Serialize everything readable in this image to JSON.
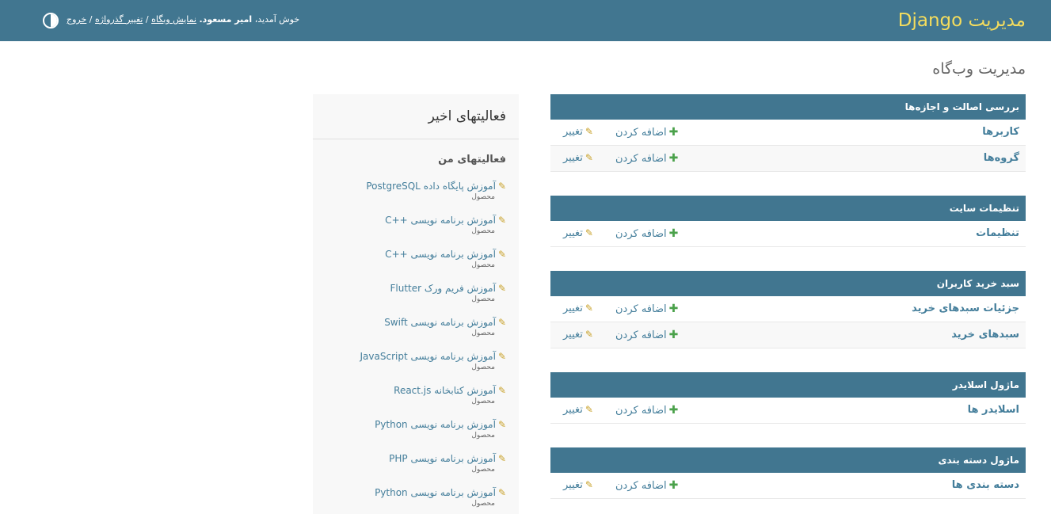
{
  "header": {
    "brand": "مدیریت Django",
    "welcome": "خوش آمدید،",
    "username": "امیر مسعود.",
    "view_site": "نمایش وبگاه",
    "change_password": "تغییر گذرواژه",
    "logout": "خروج",
    "separator": "/"
  },
  "page_title": "مدیریت وب‌گاه",
  "add_label": "اضافه کردن",
  "change_label": "تغییر",
  "modules": [
    {
      "caption": "بررسی اصالت و اجازه‌ها",
      "models": [
        "کاربرها",
        "گروه‌ها"
      ]
    },
    {
      "caption": "تنظیمات سایت",
      "models": [
        "تنظیمات"
      ]
    },
    {
      "caption": "سبد خرید کاربران",
      "models": [
        "جزئیات سبدهای خرید",
        "سبدهای خرید"
      ]
    },
    {
      "caption": "ماژول اسلایدر",
      "models": [
        "اسلایدر ها"
      ]
    },
    {
      "caption": "ماژول دسته بندی",
      "models": [
        "دسته بندی ها"
      ]
    }
  ],
  "recent": {
    "title": "فعالیتهای اخیر",
    "subtitle": "فعالیتهای من",
    "items": [
      {
        "title": "آموزش پایگاه داده PostgreSQL",
        "type": "محصول"
      },
      {
        "title": "آموزش برنامه نویسی ++C",
        "type": "محصول"
      },
      {
        "title": "آموزش برنامه نویسی ++C",
        "type": "محصول"
      },
      {
        "title": "آموزش فریم ورک Flutter",
        "type": "محصول"
      },
      {
        "title": "آموزش برنامه نویسی Swift",
        "type": "محصول"
      },
      {
        "title": "آموزش برنامه نویسی JavaScript",
        "type": "محصول"
      },
      {
        "title": "آموزش کتابخانه React.js",
        "type": "محصول"
      },
      {
        "title": "آموزش برنامه نویسی Python",
        "type": "محصول"
      },
      {
        "title": "آموزش برنامه نویسی PHP",
        "type": "محصول"
      },
      {
        "title": "آموزش برنامه نویسی Python",
        "type": "محصول"
      }
    ]
  },
  "colors": {
    "header_bg": "#417690",
    "brand": "#f5dd5d",
    "link": "#447e9b",
    "add_icon": "#4aa14a",
    "change_icon": "#c9a22b"
  }
}
